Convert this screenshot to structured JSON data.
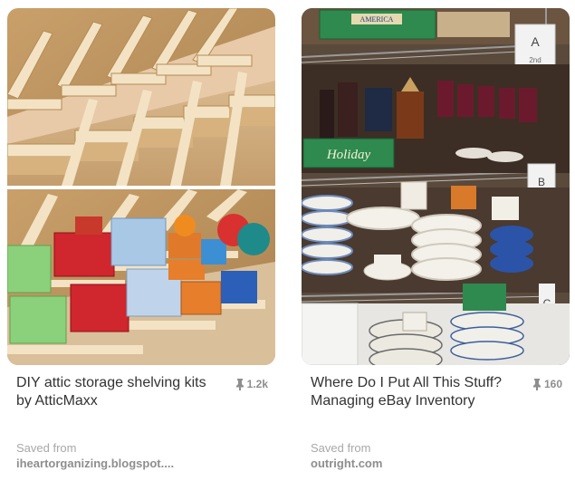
{
  "pins": [
    {
      "title": "DIY attic storage shelving kits by AtticMaxx",
      "repin_count": "1.2k",
      "saved_from_label": "Saved from",
      "source": "iheartorganizing.blogspot...."
    },
    {
      "title": "Where Do I Put All This Stuff? Managing eBay Inventory",
      "repin_count": "160",
      "saved_from_label": "Saved from",
      "source": "outright.com",
      "image_text": {
        "box_label": "AMERICA",
        "holiday_label": "Holiday",
        "sign_a": "A",
        "sign_a_sub": "2nd",
        "sign_b": "B",
        "sign_c": "C"
      }
    }
  ],
  "icons": {
    "repin": "pushpin-icon"
  }
}
